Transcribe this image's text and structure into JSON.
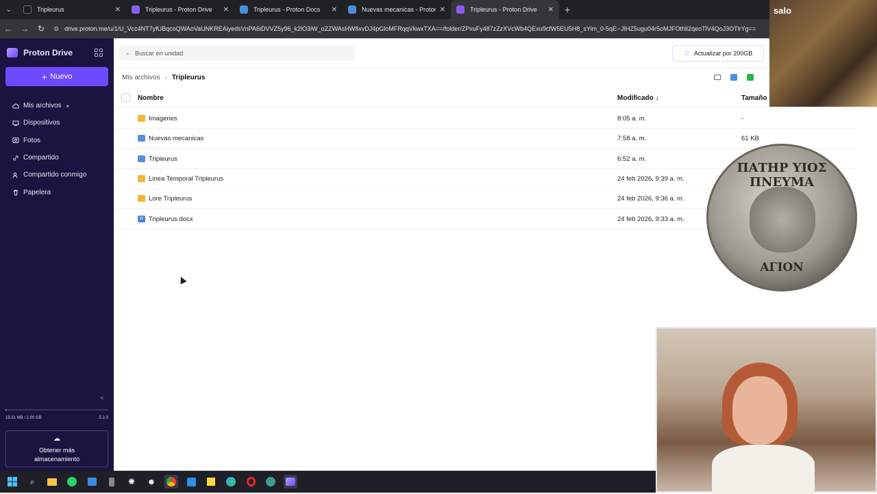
{
  "browser": {
    "tabs": [
      {
        "label": "Tripleurus",
        "color": "#1c1c1c",
        "active": false
      },
      {
        "label": "Tripleurus - Proton Drive",
        "color": "#8b5cf6",
        "active": false
      },
      {
        "label": "Tripleurus - Proton Docs",
        "color": "#4a90d9",
        "active": false
      },
      {
        "label": "Nuevas mecanicas - Proton Do",
        "color": "#4a90d9",
        "active": false
      },
      {
        "label": "Tripleurus - Proton Drive",
        "color": "#8b5cf6",
        "active": true
      }
    ],
    "url": "drive.proton.me/u/1/U_Vcc4NT7yfUBqcoQWAoVaUNKREAiyedsVnPA6iDVVZ5y96_k2lO3iW_oZZWAsHW8xvDJ4pGloMFRqqVkwxTXA==/folder/ZPxuFy487zZzXVcWb4QExu9cfW5EU5H8_sYim_0-5qE--JIHZ5ugu04r5oMJFOthll2qeoTlV4QoJ3OTlrYg=="
  },
  "sidebar": {
    "brand": "Proton Drive",
    "new_label": "Nuevo",
    "items": [
      {
        "label": "Mis archivos",
        "icon": "cloud-icon",
        "caret": "▸"
      },
      {
        "label": "Dispositivos",
        "icon": "devices-icon"
      },
      {
        "label": "Fotos",
        "icon": "photos-icon"
      },
      {
        "label": "Compartido",
        "icon": "link-icon"
      },
      {
        "label": "Compartido conmigo",
        "icon": "users-icon"
      },
      {
        "label": "Papelera",
        "icon": "trash-icon"
      }
    ],
    "storage_used": "15.51 MB / 2.00 GB",
    "storage_right": "5.2.0",
    "storage_fraction": 0.008,
    "getmore_line1": "Obtener más",
    "getmore_line2": "almacenamiento"
  },
  "main": {
    "search_placeholder": "Buscar en unidad",
    "upgrade_label": "Actualizar por 200GB",
    "breadcrumb": {
      "root": "Mis archivos",
      "current": "Tripleurus"
    },
    "columns": {
      "name": "Nombre",
      "modified": "Modificado",
      "sort_arrow": "↓",
      "size": "Tamaño"
    },
    "rows": [
      {
        "name": "Imagenes",
        "type": "folder",
        "modified": "8:05 a. m.",
        "size": "-"
      },
      {
        "name": "Nuevas mecanicas",
        "type": "doc",
        "modified": "7:58 a. m.",
        "size": "61 KB"
      },
      {
        "name": "Tripleurus",
        "type": "doc",
        "modified": "6:52 a. m.",
        "size": ""
      },
      {
        "name": "Linea Temporal Tripleurus",
        "type": "folder",
        "modified": "24 feb 2026, 9:39 a. m.",
        "size": ""
      },
      {
        "name": "Lore Tripleurus",
        "type": "folder",
        "modified": "24 feb 2026, 9:36 a. m.",
        "size": ""
      },
      {
        "name": "Tripleurus.docx",
        "type": "word",
        "modified": "24 feb 2026, 9:33 a. m.",
        "size": ""
      }
    ]
  },
  "overlays": {
    "top_right_text": "salo",
    "coin_top": "ΠΑΤΗΡ ΥΙΟΣ ΠΝΕΥΜΑ",
    "coin_bottom": "ΑΓΙΟΝ"
  },
  "taskbar": {
    "items": [
      "windows-start-icon",
      "search-icon",
      "file-explorer-icon",
      "whatsapp-icon",
      "store-icon",
      "phone-icon",
      "openai-icon",
      "cat-app-icon",
      "chrome-icon",
      "vscode-icon",
      "sticky-notes-icon",
      "edge-icon",
      "opera-icon",
      "globe-icon",
      "proton-drive-icon"
    ]
  }
}
